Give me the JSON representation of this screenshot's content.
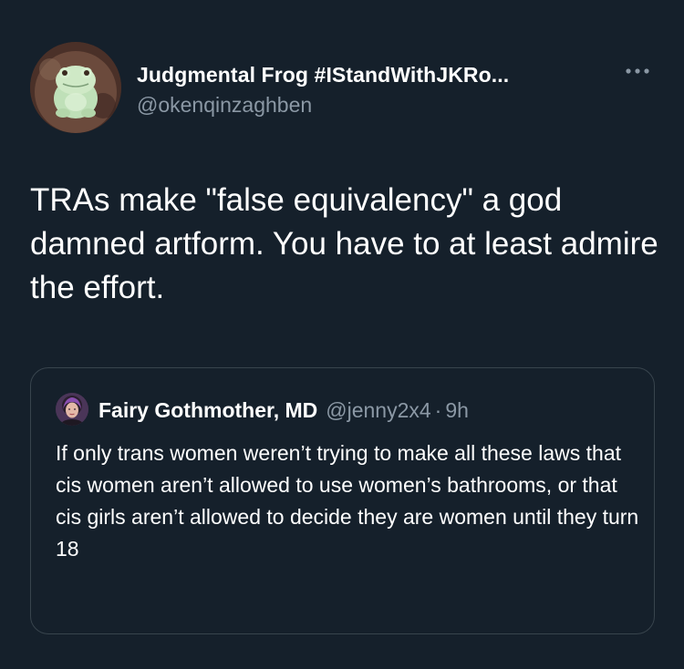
{
  "tweet": {
    "author": {
      "display_name": "Judgmental Frog #IStandWithJKRo...",
      "handle": "@okenqinzaghben",
      "avatar_icon": "frog-avatar"
    },
    "more_icon": "more-horizontal-icon",
    "text": "TRAs make \"false equivalency\" a god damned artform. You have to at least admire the effort."
  },
  "quoted_tweet": {
    "author": {
      "display_name": "Fairy Gothmother, MD",
      "handle": "@jenny2x4",
      "avatar_icon": "user-avatar"
    },
    "separator": "·",
    "time": "9h",
    "text": "If only trans women weren’t trying to make all these laws that cis women aren’t allowed to use women’s bathrooms, or that cis girls aren’t allowed to decide they are women until they turn 18"
  },
  "colors": {
    "background": "#15202b",
    "primary_text": "#ffffff",
    "secondary_text": "#8b98a5",
    "border": "#38444d"
  }
}
